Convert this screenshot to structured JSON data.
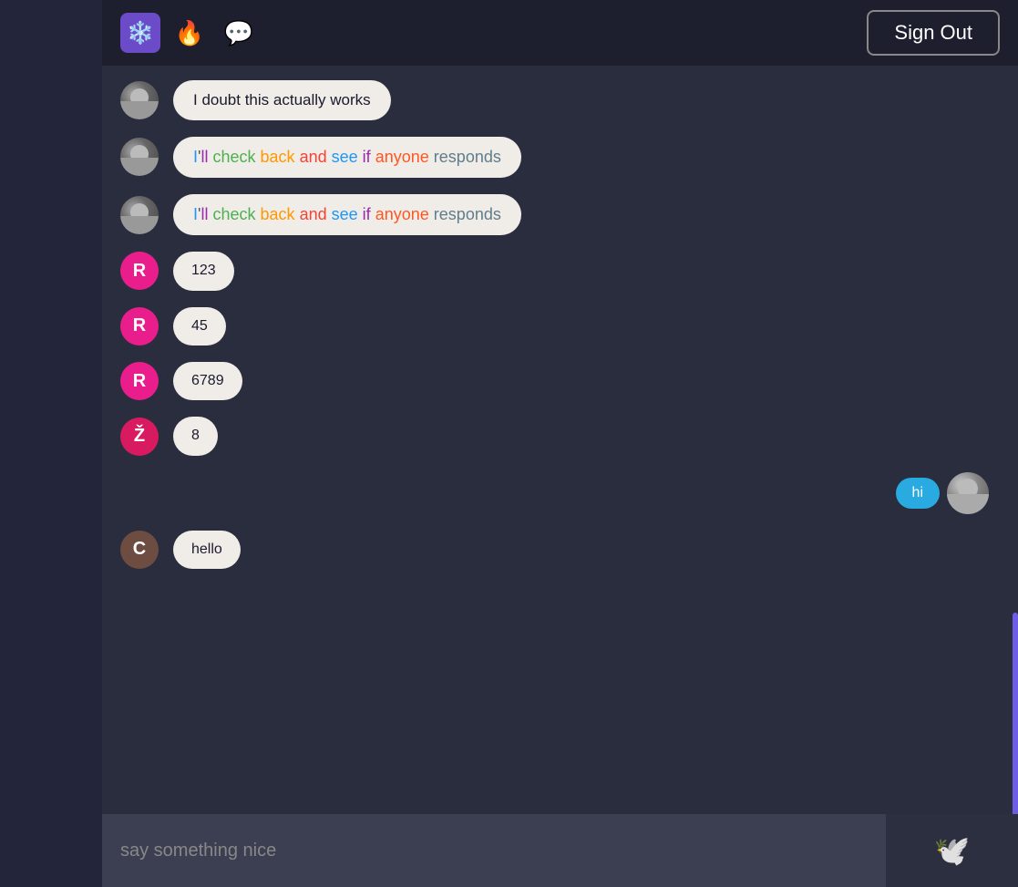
{
  "header": {
    "sign_out_label": "Sign Out",
    "icons": [
      {
        "name": "snowflake-icon",
        "emoji": "❄️",
        "bg": "#6c4bc9"
      },
      {
        "name": "fire-icon",
        "emoji": "🔥"
      },
      {
        "name": "chat-icon",
        "emoji": "💬"
      }
    ]
  },
  "messages": [
    {
      "id": "msg-1",
      "avatar_type": "photo",
      "avatar_label": "user-photo-avatar",
      "text": "I doubt this actually works",
      "bubble_style": "normal"
    },
    {
      "id": "msg-2",
      "avatar_type": "photo",
      "avatar_label": "user-photo-avatar-2",
      "text": "I'll check back and see if anyone responds",
      "bubble_style": "multicolor"
    },
    {
      "id": "msg-3",
      "avatar_type": "photo",
      "avatar_label": "user-photo-avatar-3",
      "text": "I'll check back and see if anyone responds",
      "bubble_style": "multicolor"
    },
    {
      "id": "msg-4",
      "avatar_type": "letter",
      "avatar_letter": "R",
      "avatar_color": "letter-r",
      "text": "123",
      "bubble_style": "short"
    },
    {
      "id": "msg-5",
      "avatar_type": "letter",
      "avatar_letter": "R",
      "avatar_color": "letter-r",
      "text": "45",
      "bubble_style": "short"
    },
    {
      "id": "msg-6",
      "avatar_type": "letter",
      "avatar_letter": "R",
      "avatar_color": "letter-r",
      "text": "6789",
      "bubble_style": "short"
    },
    {
      "id": "msg-7",
      "avatar_type": "letter",
      "avatar_letter": "Ž",
      "avatar_color": "letter-z",
      "text": "8",
      "bubble_style": "short"
    }
  ],
  "reactions": {
    "bubble_text": "hi"
  },
  "bottom_message": {
    "avatar_type": "letter",
    "avatar_letter": "C",
    "avatar_color": "letter-c",
    "text": "hello"
  },
  "input": {
    "placeholder": "say something nice"
  },
  "send_icon": "🕊️"
}
